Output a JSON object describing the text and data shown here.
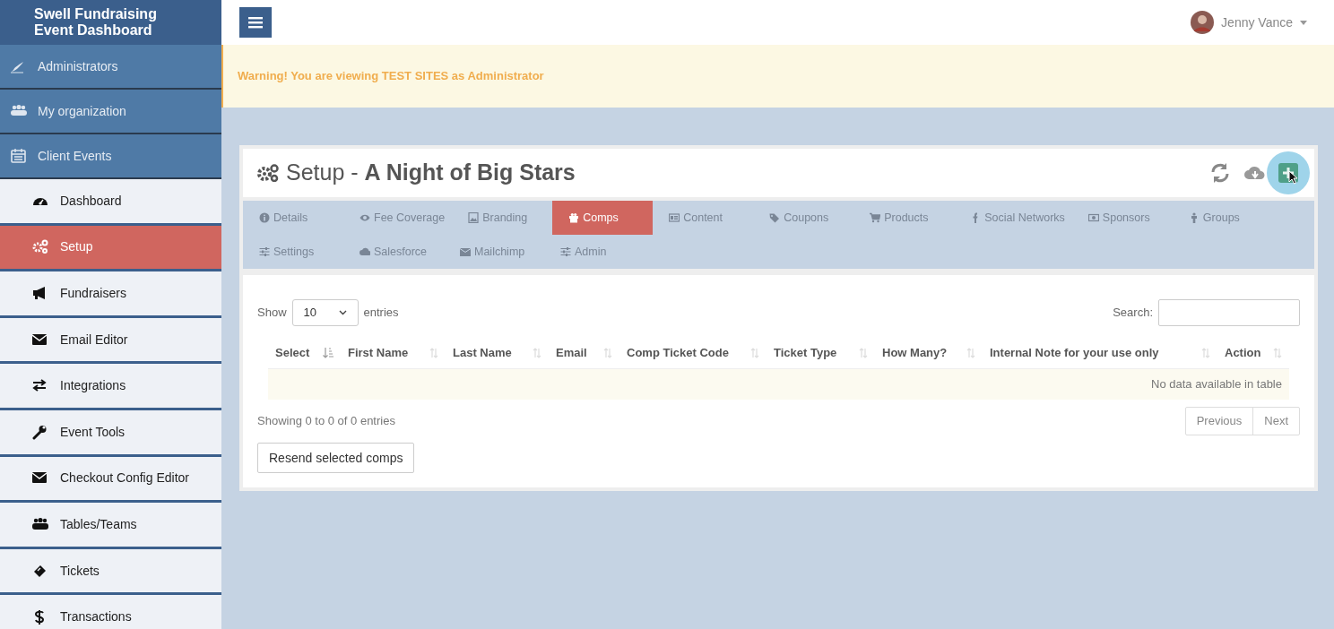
{
  "brand": {
    "lines": [
      "Swell Fundraising",
      "Event Dashboard"
    ]
  },
  "sidebar": {
    "items": [
      {
        "label": "Administrators"
      },
      {
        "label": "My organization"
      },
      {
        "label": "Client Events",
        "children": [
          {
            "label": "Dashboard",
            "selected": false
          },
          {
            "label": "Setup",
            "selected": true
          },
          {
            "label": "Fundraisers",
            "selected": false
          },
          {
            "label": "Email Editor",
            "selected": false
          },
          {
            "label": "Integrations",
            "selected": false
          },
          {
            "label": "Event Tools",
            "selected": false
          },
          {
            "label": "Checkout Config Editor",
            "selected": false
          },
          {
            "label": "Tables/Teams",
            "selected": false
          },
          {
            "label": "Tickets",
            "selected": false
          },
          {
            "label": "Transactions",
            "selected": false
          }
        ]
      }
    ]
  },
  "user": {
    "name": "Jenny Vance"
  },
  "warning": "Warning! You are viewing TEST SITES as Administrator",
  "page_title": "Setup - **A Night of Big Stars**",
  "toolbar": [
    {
      "kind": "refresh",
      "hovered": false
    },
    {
      "kind": "download",
      "hovered": false
    },
    {
      "kind": "add",
      "hovered": true
    }
  ],
  "tabs": [
    {
      "label": "Details",
      "selected": false
    },
    {
      "label": "Fee Coverage",
      "selected": false
    },
    {
      "label": "Branding",
      "selected": false
    },
    {
      "label": "Comps",
      "selected": true
    },
    {
      "label": "Content",
      "selected": false
    },
    {
      "label": "Coupons",
      "selected": false
    },
    {
      "label": "Products",
      "selected": false
    },
    {
      "label": "Social Networks",
      "selected": false
    },
    {
      "label": "Sponsors",
      "selected": false
    },
    {
      "label": "Groups",
      "selected": false
    },
    {
      "label": "Settings",
      "selected": false
    },
    {
      "label": "Salesforce",
      "selected": false
    },
    {
      "label": "Mailchimp",
      "selected": false
    },
    {
      "label": "Admin",
      "selected": false
    }
  ],
  "table": {
    "show_label": "Show",
    "page_length": "10",
    "entries_label": "entries",
    "search_label": "Search:",
    "columns": [
      {
        "label": "Select",
        "sorted": true
      },
      {
        "label": "First Name",
        "sorted": false
      },
      {
        "label": "Last Name",
        "sorted": false
      },
      {
        "label": "Email",
        "sorted": false
      },
      {
        "label": "Comp Ticket Code",
        "sorted": false
      },
      {
        "label": "Ticket Type",
        "sorted": false
      },
      {
        "label": "How Many?",
        "sorted": false
      },
      {
        "label": "Internal Note for your use only",
        "sorted": false
      },
      {
        "label": "Action",
        "sorted": false
      }
    ],
    "empty_message": "No data available in table",
    "info": "Showing 0 to 0 of 0 entries",
    "pagination": [
      "Previous",
      "Next"
    ]
  },
  "resend_button": "Resend selected comps"
}
